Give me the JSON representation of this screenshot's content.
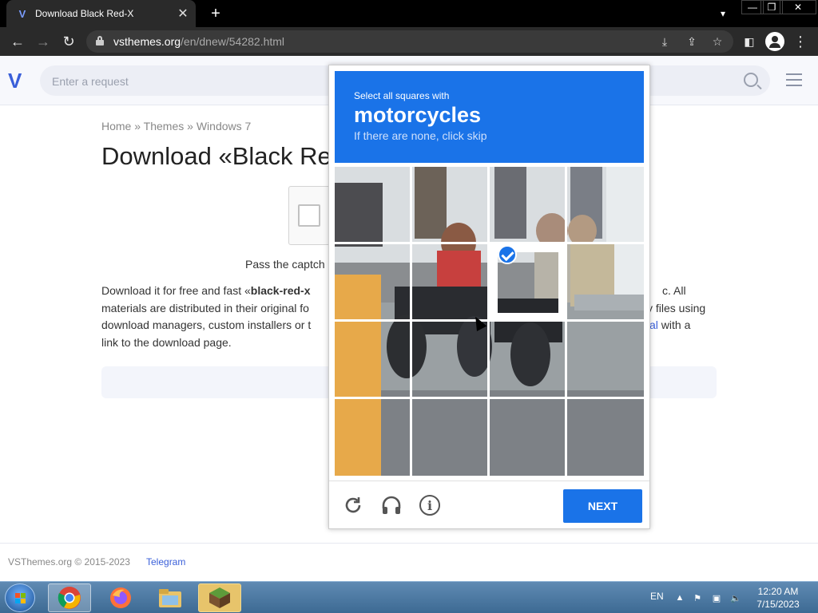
{
  "browser": {
    "tab_title": "Download Black Red-X",
    "tab_close": "✕",
    "new_tab": "+",
    "url_host": "vsthemes.org",
    "url_path": "/en/dnew/54282.html",
    "window_controls": {
      "minimize": "—",
      "maximize": "❐",
      "close": "✕"
    }
  },
  "site": {
    "search_placeholder": "Enter a request",
    "breadcrumb": {
      "home": "Home",
      "sep": " » ",
      "themes": "Themes",
      "win7": "Windows 7"
    },
    "title": "Download «Black Re",
    "pass_text": "Pass the captch",
    "description": {
      "l1a": "Download it for free and fast «",
      "l1b": "black-red-x",
      "l1c": "c. All",
      "l2a": "materials are distributed in their original fo",
      "l2b": "y files using",
      "l3a": "download managers, custom installers or t",
      "l3b": "al",
      "l3c": " with a",
      "l4": "link to the download page."
    },
    "footer": {
      "copyright": "VSThemes.org © 2015-2023",
      "telegram": "Telegram"
    }
  },
  "captcha": {
    "instruction": "Select all squares with",
    "object": "motorcycles",
    "skip_hint": "If there are none, click skip",
    "next_label": "NEXT",
    "selected_tiles": [
      5
    ],
    "colors": {
      "accent": "#1a73e8"
    }
  },
  "taskbar": {
    "apps": [
      "chrome-icon",
      "firefox-icon",
      "file-explorer-icon",
      "minecraft-icon"
    ],
    "language": "EN",
    "time": "12:20 AM",
    "date": "7/15/2023"
  }
}
